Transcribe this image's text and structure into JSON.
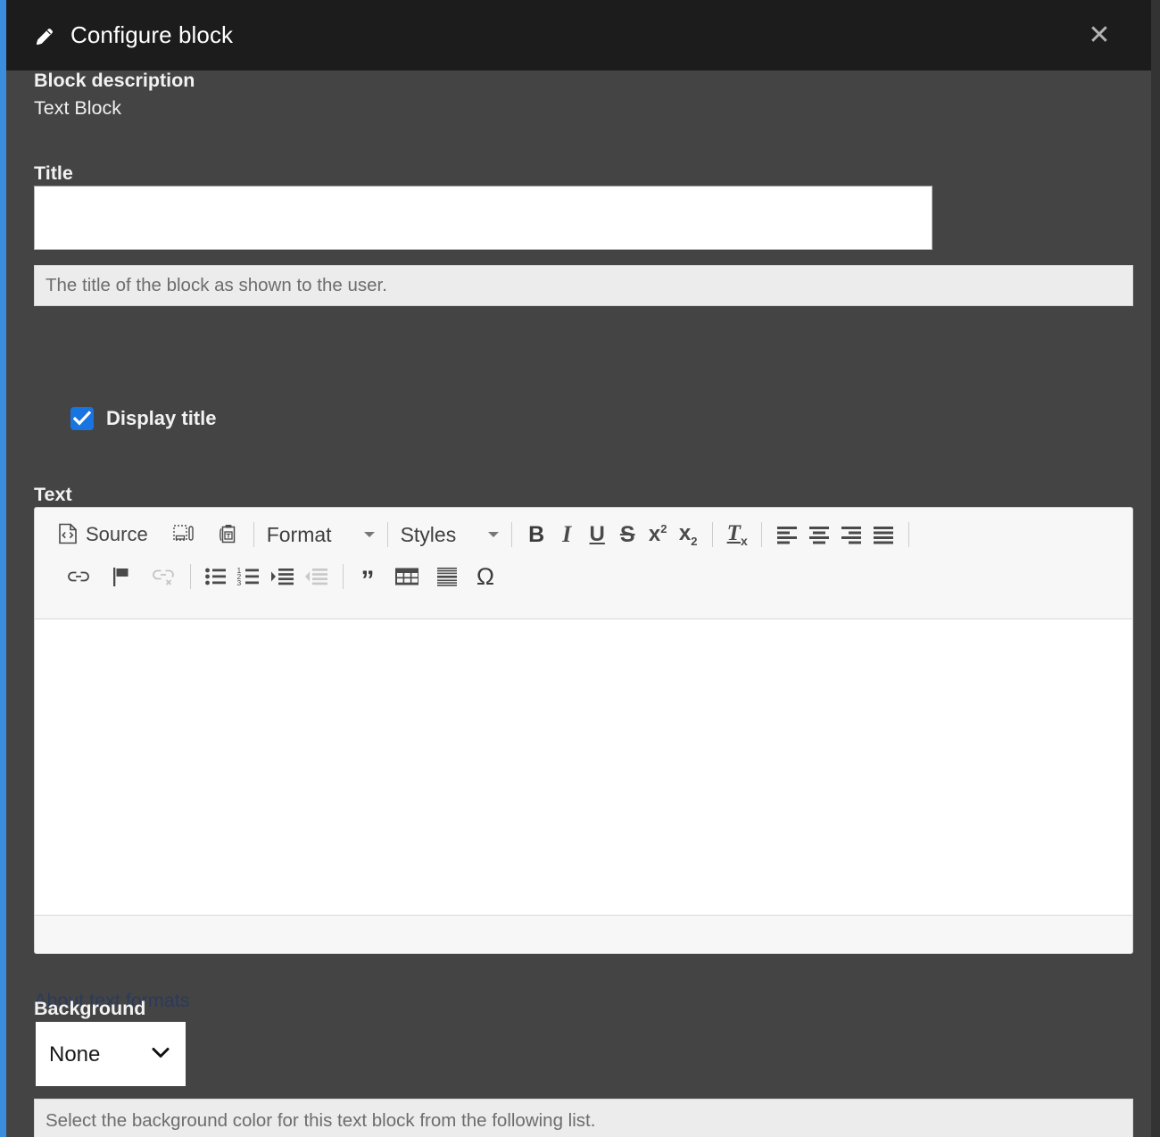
{
  "header": {
    "title": "Configure block",
    "icon": "pencil-icon",
    "close_label": "✕",
    "bg_color": "#1c1c1c",
    "accent_color": "#3b8ede"
  },
  "form": {
    "block_description": {
      "label": "Block description",
      "value": "Text Block"
    },
    "title": {
      "label": "Title",
      "value": "",
      "placeholder": "",
      "description": "The title of the block as shown to the user."
    },
    "display_title": {
      "label": "Display title",
      "checked": true,
      "checkbox_color": "#1874e0"
    },
    "text": {
      "label": "Text",
      "content": ""
    },
    "about_text_formats": {
      "label": "About text formats"
    },
    "background": {
      "label": "Background",
      "selected": "None",
      "options": [
        "None"
      ],
      "description": "Select the background color for this text block from the following list."
    }
  },
  "editor": {
    "toolbar_row_1": [
      {
        "name": "source-button",
        "label": "Source",
        "type": "text-icon",
        "disabled": false
      },
      {
        "name": "paste-from-word-icon",
        "label": "",
        "type": "icon",
        "disabled": false
      },
      {
        "name": "paste-as-plain-text-icon",
        "label": "",
        "type": "icon",
        "disabled": false
      },
      {
        "name": "separator",
        "label": "",
        "type": "sep",
        "disabled": false
      },
      {
        "name": "format-dropdown",
        "label": "Format",
        "type": "combo",
        "disabled": false
      },
      {
        "name": "separator",
        "label": "",
        "type": "sep",
        "disabled": false
      },
      {
        "name": "styles-dropdown",
        "label": "Styles",
        "type": "combo",
        "disabled": false
      },
      {
        "name": "separator",
        "label": "",
        "type": "sep",
        "disabled": false
      },
      {
        "name": "bold-button",
        "label": "B",
        "type": "text",
        "disabled": false
      },
      {
        "name": "italic-button",
        "label": "I",
        "type": "text",
        "disabled": false
      },
      {
        "name": "underline-button",
        "label": "U",
        "type": "text",
        "disabled": false
      },
      {
        "name": "strikethrough-button",
        "label": "S",
        "type": "text",
        "disabled": false
      },
      {
        "name": "superscript-button",
        "label": "x2",
        "type": "text",
        "disabled": false
      },
      {
        "name": "subscript-button",
        "label": "x2",
        "type": "text",
        "disabled": false
      },
      {
        "name": "separator",
        "label": "",
        "type": "sep",
        "disabled": false
      },
      {
        "name": "remove-format-button",
        "label": "Tx",
        "type": "text",
        "disabled": false
      },
      {
        "name": "separator",
        "label": "",
        "type": "sep",
        "disabled": false
      },
      {
        "name": "align-left-icon",
        "label": "",
        "type": "icon",
        "disabled": false
      },
      {
        "name": "align-center-icon",
        "label": "",
        "type": "icon",
        "disabled": false
      },
      {
        "name": "align-right-icon",
        "label": "",
        "type": "icon",
        "disabled": false
      },
      {
        "name": "justify-icon",
        "label": "",
        "type": "icon",
        "disabled": false
      },
      {
        "name": "separator",
        "label": "",
        "type": "sep",
        "disabled": false
      }
    ],
    "toolbar_row_2": [
      {
        "name": "link-icon",
        "label": "",
        "disabled": false
      },
      {
        "name": "anchor-flag-icon",
        "label": "",
        "disabled": false
      },
      {
        "name": "unlink-icon",
        "label": "",
        "disabled": true
      },
      {
        "name": "separator",
        "label": "",
        "disabled": false
      },
      {
        "name": "bulleted-list-icon",
        "label": "",
        "disabled": false
      },
      {
        "name": "numbered-list-icon",
        "label": "",
        "disabled": false
      },
      {
        "name": "increase-indent-icon",
        "label": "",
        "disabled": false
      },
      {
        "name": "decrease-indent-icon",
        "label": "",
        "disabled": true
      },
      {
        "name": "separator",
        "label": "",
        "disabled": false
      },
      {
        "name": "blockquote-icon",
        "label": "”",
        "disabled": false
      },
      {
        "name": "table-icon",
        "label": "",
        "disabled": false
      },
      {
        "name": "horizontal-rule-icon",
        "label": "",
        "disabled": false
      },
      {
        "name": "special-character-icon",
        "label": "Ω",
        "disabled": false
      }
    ]
  },
  "colors": {
    "panel_bg": "#444444",
    "header_bg": "#1c1c1c",
    "accent_blue": "#3b8ede",
    "checkbox_blue": "#1874e0",
    "description_bg": "#ececec",
    "editor_bg": "#f7f7f7",
    "link_color": "#2b3a5c"
  }
}
